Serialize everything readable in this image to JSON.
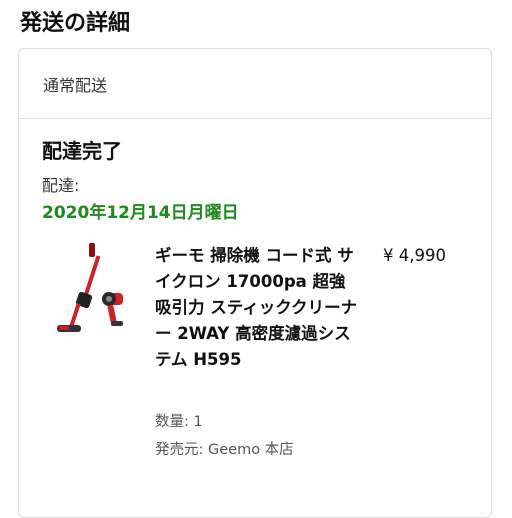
{
  "section": {
    "title": "発送の詳細"
  },
  "shipment": {
    "method": "通常配送",
    "status": "配達完了",
    "delivery_label": "配達:",
    "delivery_date": "2020年12月14日月曜日"
  },
  "item": {
    "name": "ギーモ 掃除機 コード式 サイクロン 17000pa 超強吸引力 スティッククリーナー 2WAY 高密度濾過システム H595",
    "price": "¥ 4,990",
    "quantity": "数量: 1",
    "seller": "発売元: Geemo 本店",
    "thumbnail_icon": "stick-vacuum-cleaner-image"
  },
  "colors": {
    "delivered_green": "#1e8a1e",
    "vacuum_red": "#d0202a"
  }
}
